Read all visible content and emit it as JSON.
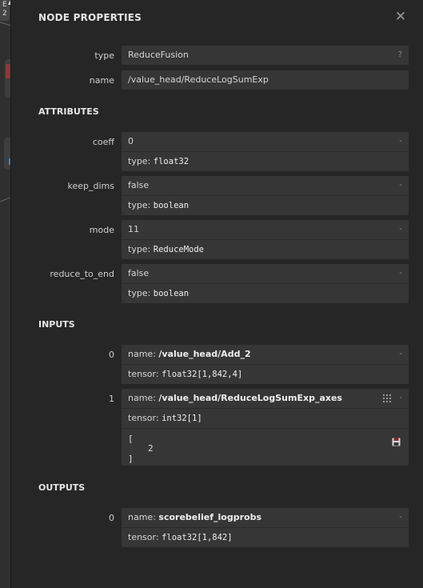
{
  "panel": {
    "title": "NODE PROPERTIES",
    "close_glyph": "✕"
  },
  "canvas": {
    "node_label": "E",
    "node_sub": "2",
    "arrow": "▲"
  },
  "properties": {
    "type": {
      "label": "type",
      "value": "ReduceFusion",
      "mark": "?"
    },
    "name": {
      "label": "name",
      "value": "/value_head/ReduceLogSumExp"
    }
  },
  "attributes": {
    "title": "ATTRIBUTES",
    "items": [
      {
        "label": "coeff",
        "value": "0",
        "type_prefix": "type:",
        "type": "float32",
        "mark": "-"
      },
      {
        "label": "keep_dims",
        "value": "false",
        "type_prefix": "type:",
        "type": "boolean",
        "mark": "-"
      },
      {
        "label": "mode",
        "value": "11",
        "type_prefix": "type:",
        "type": "ReduceMode",
        "mark": "-"
      },
      {
        "label": "reduce_to_end",
        "value": "false",
        "type_prefix": "type:",
        "type": "boolean",
        "mark": "-"
      }
    ]
  },
  "inputs": {
    "title": "INPUTS",
    "items": [
      {
        "index": "0",
        "name_prefix": "name:",
        "name": "/value_head/Add_2",
        "tensor_prefix": "tensor:",
        "tensor": "float32[1,842,4]",
        "mark": "-"
      },
      {
        "index": "1",
        "name_prefix": "name:",
        "name": "/value_head/ReduceLogSumExp_axes",
        "tensor_prefix": "tensor:",
        "tensor": "int32[1]",
        "mark": "-",
        "value_lines": [
          "[",
          "2",
          "]"
        ]
      }
    ]
  },
  "outputs": {
    "title": "OUTPUTS",
    "items": [
      {
        "index": "0",
        "name_prefix": "name:",
        "name": "scorebelief_logprobs",
        "tensor_prefix": "tensor:",
        "tensor": "float32[1,842]",
        "mark": "-"
      }
    ]
  }
}
